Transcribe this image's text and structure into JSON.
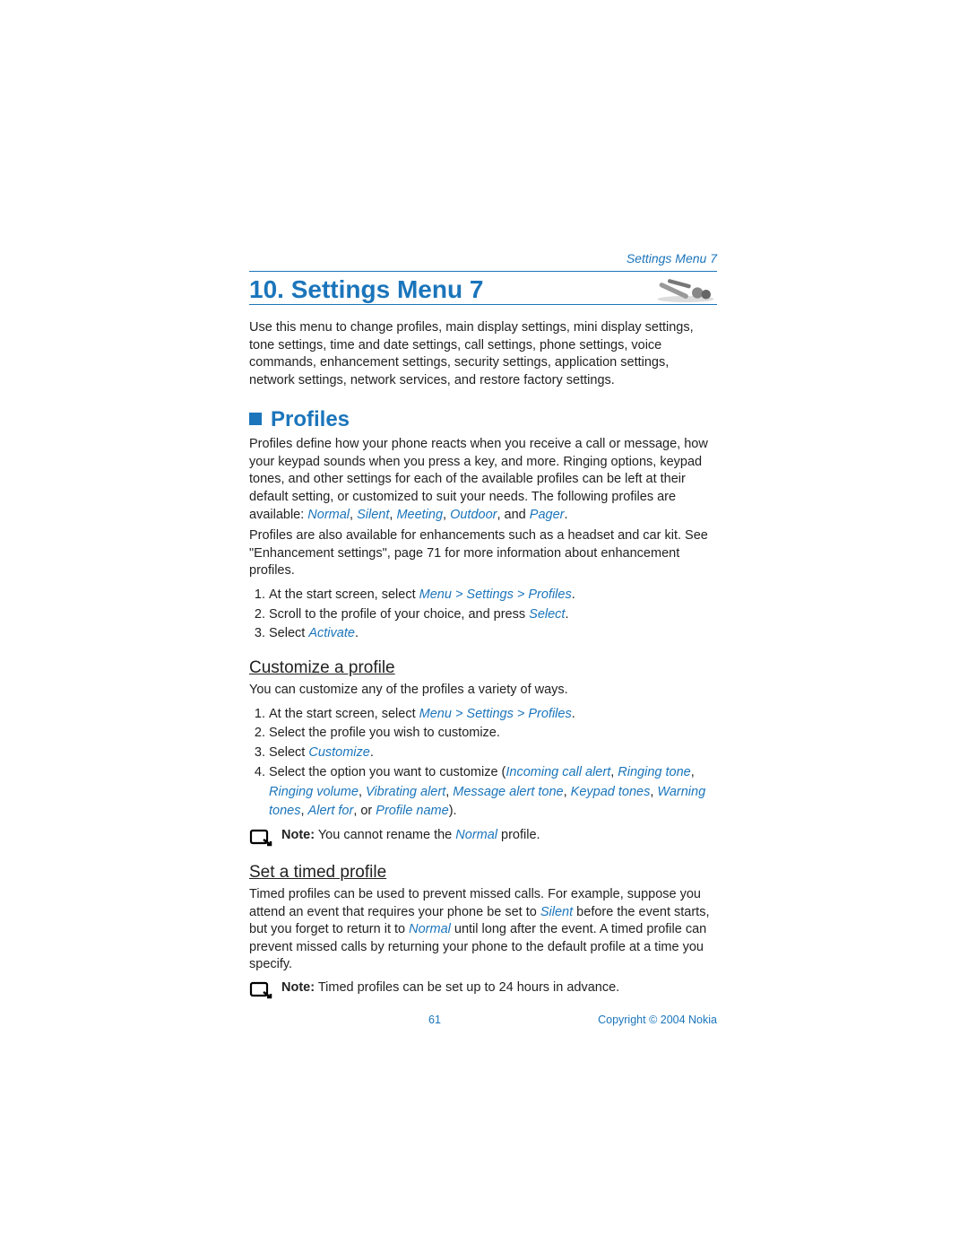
{
  "header": {
    "running": "Settings Menu 7"
  },
  "chapter": {
    "title": "10. Settings Menu 7"
  },
  "intro": "Use this menu to change profiles, main display settings, mini display settings, tone settings, time and date settings, call settings, phone settings, voice commands, enhancement settings, security settings, application settings, network settings, network services, and restore factory settings.",
  "profiles": {
    "title": "Profiles",
    "p1_a": "Profiles define how your phone reacts when you receive a call or message, how your keypad sounds when you press a key, and more. Ringing options, keypad tones, and other settings for each of the available profiles can be left at their default setting, or customized to suit your needs. The following profiles are available: ",
    "list1": "Normal",
    "sep1": ", ",
    "list2": "Silent",
    "sep2": ", ",
    "list3": "Meeting",
    "sep3": ", ",
    "list4": "Outdoor",
    "sep4": ", and ",
    "list5": "Pager",
    "p1_end": ".",
    "p2": "Profiles are also available for enhancements such as a headset and car kit. See \"Enhancement settings\", page 71 for more information about enhancement profiles.",
    "steps": {
      "s1_a": "At the start screen, select ",
      "s1_b": "Menu > Settings > Profiles",
      "s1_c": ".",
      "s2_a": "Scroll to the profile of your choice, and press ",
      "s2_b": "Select",
      "s2_c": ".",
      "s3_a": "Select ",
      "s3_b": "Activate",
      "s3_c": "."
    }
  },
  "customize": {
    "title": "Customize a profile",
    "intro": "You can customize any of the profiles a variety of ways.",
    "steps": {
      "s1_a": "At the start screen, select ",
      "s1_b": "Menu > Settings > Profiles",
      "s1_c": ".",
      "s2": "Select the profile you wish to customize.",
      "s3_a": "Select ",
      "s3_b": "Customize",
      "s3_c": ".",
      "s4_a": "Select the option you want to customize (",
      "s4_b": "Incoming call alert",
      "s4_c": ", ",
      "s4_d": "Ringing tone",
      "s4_e": ", ",
      "s4_f": "Ringing volume",
      "s4_g": ", ",
      "s4_h": "Vibrating alert",
      "s4_i": ", ",
      "s4_j": "Message alert tone",
      "s4_k": ", ",
      "s4_l": "Keypad tones",
      "s4_m": ", ",
      "s4_n": "Warning tones",
      "s4_o": ", ",
      "s4_p": "Alert for",
      "s4_q": ", or ",
      "s4_r": "Profile name",
      "s4_s": ")."
    },
    "note_a": "Note:",
    "note_b": " You cannot rename the ",
    "note_c": "Normal",
    "note_d": " profile."
  },
  "timed": {
    "title": "Set a timed profile",
    "p_a": "Timed profiles can be used to prevent missed calls. For example, suppose you attend an event that requires your phone be set to ",
    "p_b": "Silent",
    "p_c": " before the event starts, but you forget to return it to ",
    "p_d": "Normal",
    "p_e": " until long after the event. A timed profile can prevent missed calls by returning your phone to the default profile at a time you specify.",
    "note_a": "Note:",
    "note_b": " Timed profiles can be set up to 24 hours in advance."
  },
  "footer": {
    "page": "61",
    "copyright": "Copyright © 2004 Nokia"
  }
}
